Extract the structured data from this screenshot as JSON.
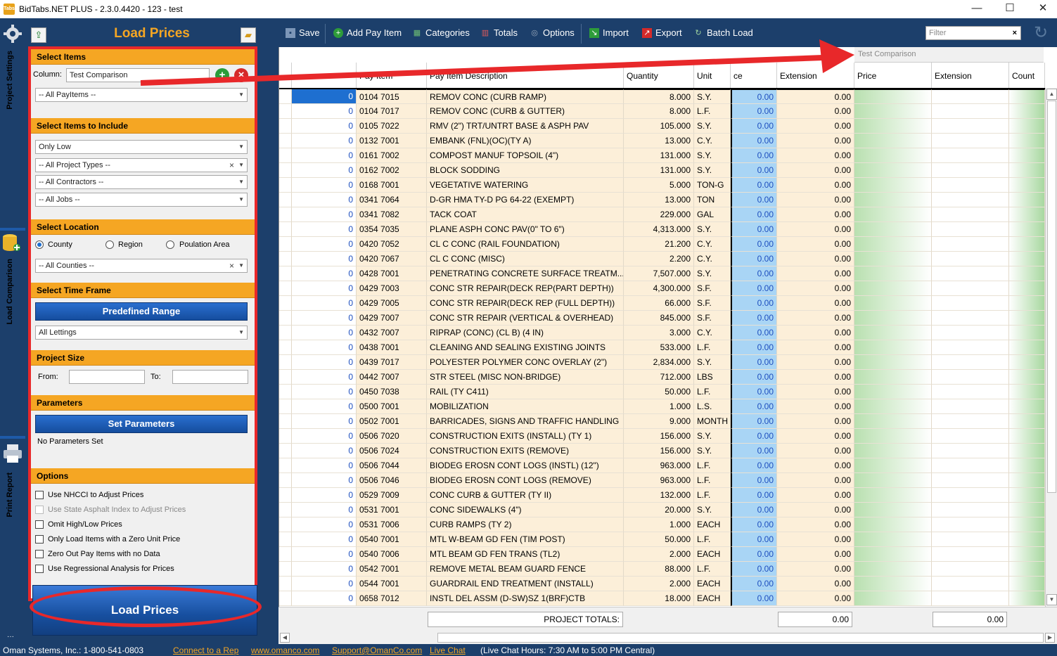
{
  "window": {
    "title": "BidTabs.NET PLUS - 2.3.0.4420 - 123 - test",
    "app_icon_text": "Tabs",
    "controls": [
      "—",
      "☐",
      "✕"
    ]
  },
  "side_tabs": [
    "Project Settings",
    "Load Comparison",
    "Print Report"
  ],
  "panel": {
    "title": "Load Prices",
    "select_items": {
      "header": "Select Items",
      "column_label": "Column:",
      "column_value": "Test Comparison",
      "payitems_value": "-- All PayItems --"
    },
    "include": {
      "header": "Select Items to Include",
      "only_low": "Only Low",
      "project_types": "-- All Project Types --",
      "contractors": "-- All Contractors --",
      "jobs": "-- All Jobs --"
    },
    "location": {
      "header": "Select Location",
      "county": "County",
      "region": "Region",
      "population": "Poulation Area",
      "counties": "-- All Counties --"
    },
    "timeframe": {
      "header": "Select Time Frame",
      "button": "Predefined Range",
      "lettings": "All Lettings"
    },
    "size": {
      "header": "Project Size",
      "from": "From:",
      "to": "To:"
    },
    "parameters": {
      "header": "Parameters",
      "button": "Set Parameters",
      "status": "No Parameters Set"
    },
    "options": {
      "header": "Options",
      "items": [
        "Use NHCCI to Adjust Prices",
        "Use State Asphalt Index to Adjust Prices",
        "Omit High/Low Prices",
        "Only Load Items with a Zero Unit  Price",
        "Zero Out Pay Items with no Data",
        "Use Regressional Analysis for Prices"
      ]
    },
    "load_button": "Load Prices"
  },
  "toolbar": {
    "save": "Save",
    "add": "Add Pay Item",
    "categories": "Categories",
    "totals": "Totals",
    "options": "Options",
    "import": "Import",
    "export": "Export",
    "batch": "Batch Load",
    "filter_placeholder": "Filter"
  },
  "grid": {
    "band_label": "Test Comparison",
    "columns": [
      "Pay Item",
      "Pay Item Description",
      "Quantity",
      "Unit",
      "ce",
      "Extension",
      "Price",
      "Extension",
      "Count"
    ],
    "rows": [
      [
        "0",
        "0104 7015",
        "REMOV CONC (CURB RAMP)",
        "8.000",
        "S.Y.",
        "0.00",
        "0.00"
      ],
      [
        "0",
        "0104 7017",
        "REMOV CONC (CURB & GUTTER)",
        "8.000",
        "L.F.",
        "0.00",
        "0.00"
      ],
      [
        "0",
        "0105 7022",
        "RMV (2\") TRT/UNTRT BASE & ASPH PAV",
        "105.000",
        "S.Y.",
        "0.00",
        "0.00"
      ],
      [
        "0",
        "0132 7001",
        "EMBANK (FNL)(OC)(TY A)",
        "13.000",
        "C.Y.",
        "0.00",
        "0.00"
      ],
      [
        "0",
        "0161 7002",
        "COMPOST MANUF TOPSOIL (4\")",
        "131.000",
        "S.Y.",
        "0.00",
        "0.00"
      ],
      [
        "0",
        "0162 7002",
        "BLOCK SODDING",
        "131.000",
        "S.Y.",
        "0.00",
        "0.00"
      ],
      [
        "0",
        "0168 7001",
        "VEGETATIVE WATERING",
        "5.000",
        "TON-G",
        "0.00",
        "0.00"
      ],
      [
        "0",
        "0341 7064",
        "D-GR HMA TY-D PG 64-22 (EXEMPT)",
        "13.000",
        "TON",
        "0.00",
        "0.00"
      ],
      [
        "0",
        "0341 7082",
        "TACK COAT",
        "229.000",
        "GAL",
        "0.00",
        "0.00"
      ],
      [
        "0",
        "0354 7035",
        "PLANE ASPH CONC PAV(0\" TO 6\")",
        "4,313.000",
        "S.Y.",
        "0.00",
        "0.00"
      ],
      [
        "0",
        "0420 7052",
        "CL C CONC (RAIL FOUNDATION)",
        "21.200",
        "C.Y.",
        "0.00",
        "0.00"
      ],
      [
        "0",
        "0420 7067",
        "CL C CONC (MISC)",
        "2.200",
        "C.Y.",
        "0.00",
        "0.00"
      ],
      [
        "0",
        "0428 7001",
        "PENETRATING CONCRETE SURFACE TREATM...",
        "7,507.000",
        "S.Y.",
        "0.00",
        "0.00"
      ],
      [
        "0",
        "0429 7003",
        "CONC STR REPAIR(DECK REP(PART DEPTH))",
        "4,300.000",
        "S.F.",
        "0.00",
        "0.00"
      ],
      [
        "0",
        "0429 7005",
        "CONC STR REPAIR(DECK REP (FULL DEPTH))",
        "66.000",
        "S.F.",
        "0.00",
        "0.00"
      ],
      [
        "0",
        "0429 7007",
        "CONC STR REPAIR (VERTICAL & OVERHEAD)",
        "845.000",
        "S.F.",
        "0.00",
        "0.00"
      ],
      [
        "0",
        "0432 7007",
        "RIPRAP (CONC) (CL B) (4 IN)",
        "3.000",
        "C.Y.",
        "0.00",
        "0.00"
      ],
      [
        "0",
        "0438 7001",
        "CLEANING AND SEALING EXISTING JOINTS",
        "533.000",
        "L.F.",
        "0.00",
        "0.00"
      ],
      [
        "0",
        "0439 7017",
        "POLYESTER POLYMER CONC OVERLAY (2\")",
        "2,834.000",
        "S.Y.",
        "0.00",
        "0.00"
      ],
      [
        "0",
        "0442 7007",
        "STR STEEL (MISC NON-BRIDGE)",
        "712.000",
        "LBS",
        "0.00",
        "0.00"
      ],
      [
        "0",
        "0450 7038",
        "RAIL (TY C411)",
        "50.000",
        "L.F.",
        "0.00",
        "0.00"
      ],
      [
        "0",
        "0500 7001",
        "MOBILIZATION",
        "1.000",
        "L.S.",
        "0.00",
        "0.00"
      ],
      [
        "0",
        "0502 7001",
        "BARRICADES, SIGNS AND TRAFFIC HANDLING",
        "9.000",
        "MONTH",
        "0.00",
        "0.00"
      ],
      [
        "0",
        "0506 7020",
        "CONSTRUCTION EXITS (INSTALL) (TY 1)",
        "156.000",
        "S.Y.",
        "0.00",
        "0.00"
      ],
      [
        "0",
        "0506 7024",
        "CONSTRUCTION EXITS (REMOVE)",
        "156.000",
        "S.Y.",
        "0.00",
        "0.00"
      ],
      [
        "0",
        "0506 7044",
        "BIODEG EROSN CONT LOGS (INSTL) (12\")",
        "963.000",
        "L.F.",
        "0.00",
        "0.00"
      ],
      [
        "0",
        "0506 7046",
        "BIODEG EROSN CONT LOGS (REMOVE)",
        "963.000",
        "L.F.",
        "0.00",
        "0.00"
      ],
      [
        "0",
        "0529 7009",
        "CONC CURB & GUTTER (TY II)",
        "132.000",
        "L.F.",
        "0.00",
        "0.00"
      ],
      [
        "0",
        "0531 7001",
        "CONC SIDEWALKS (4\")",
        "20.000",
        "S.Y.",
        "0.00",
        "0.00"
      ],
      [
        "0",
        "0531 7006",
        "CURB RAMPS (TY 2)",
        "1.000",
        "EACH",
        "0.00",
        "0.00"
      ],
      [
        "0",
        "0540 7001",
        "MTL W-BEAM GD FEN (TIM POST)",
        "50.000",
        "L.F.",
        "0.00",
        "0.00"
      ],
      [
        "0",
        "0540 7006",
        "MTL BEAM GD FEN TRANS (TL2)",
        "2.000",
        "EACH",
        "0.00",
        "0.00"
      ],
      [
        "0",
        "0542 7001",
        "REMOVE METAL BEAM GUARD FENCE",
        "88.000",
        "L.F.",
        "0.00",
        "0.00"
      ],
      [
        "0",
        "0544 7001",
        "GUARDRAIL END TREATMENT (INSTALL)",
        "2.000",
        "EACH",
        "0.00",
        "0.00"
      ],
      [
        "0",
        "0658 7012",
        "INSTL DEL ASSM (D-SW)SZ 1(BRF)CTB",
        "18.000",
        "EACH",
        "0.00",
        "0.00"
      ]
    ]
  },
  "totals": {
    "label": "PROJECT TOTALS:",
    "ext1": "0.00",
    "ext2": "0.00"
  },
  "status": {
    "company": "Oman Systems, Inc.: 1-800-541-0803",
    "rep": "Connect to a Rep",
    "web": "www.omanco.com",
    "support": "Support@OmanCo.com",
    "chat": "Live Chat",
    "hours": "(Live Chat Hours: 7:30 AM to 5:00 PM Central)"
  },
  "colors": {
    "navy": "#1c3f6b",
    "orange": "#f5a623",
    "annotation_red": "#e8282a",
    "row_tan": "#fcefd9",
    "price_blue": "#a9d5f5",
    "green": "#a8d8a0"
  }
}
